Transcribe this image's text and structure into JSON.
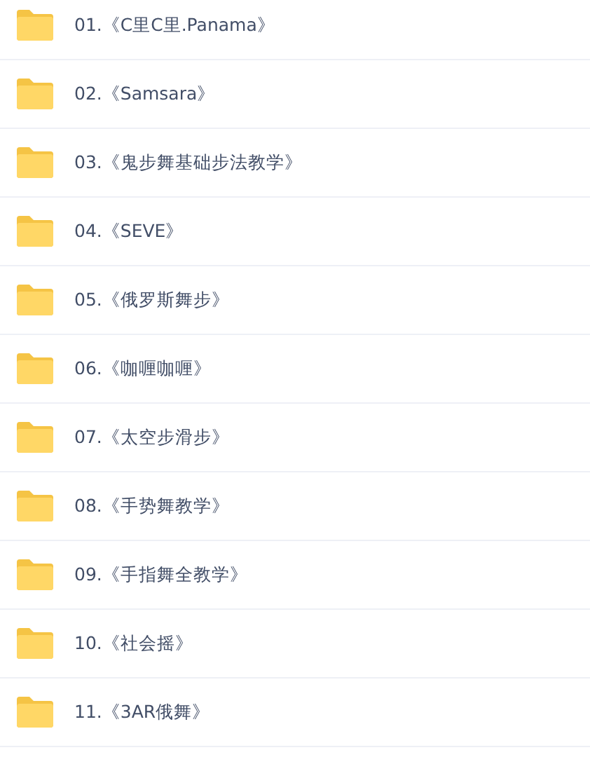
{
  "folders": [
    {
      "name": "01.《C里C里.Panama》"
    },
    {
      "name": "02.《Samsara》"
    },
    {
      "name": "03.《鬼步舞基础步法教学》"
    },
    {
      "name": "04.《SEVE》"
    },
    {
      "name": "05.《俄罗斯舞步》"
    },
    {
      "name": "06.《咖喱咖喱》"
    },
    {
      "name": "07.《太空步滑步》"
    },
    {
      "name": "08.《手势舞教学》"
    },
    {
      "name": "09.《手指舞全教学》"
    },
    {
      "name": "10.《社会摇》"
    },
    {
      "name": "11.《3AR俄舞》"
    }
  ]
}
